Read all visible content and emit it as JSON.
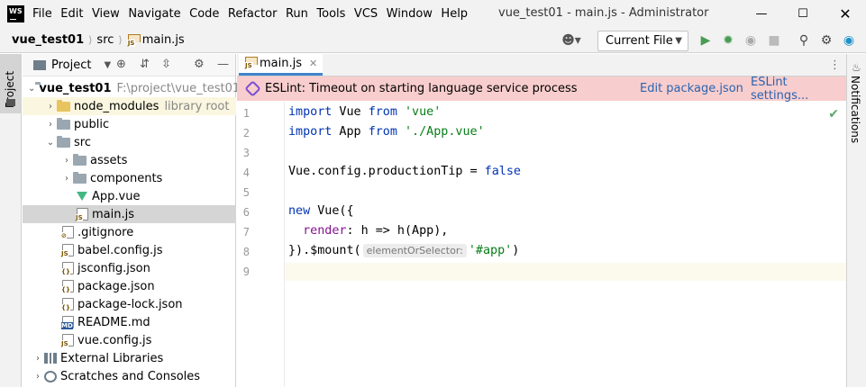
{
  "titlebar": {
    "logo": "WS",
    "menu": [
      "File",
      "Edit",
      "View",
      "Navigate",
      "Code",
      "Refactor",
      "Run",
      "Tools",
      "VCS",
      "Window",
      "Help"
    ],
    "title": "vue_test01 - main.js - Administrator"
  },
  "navbar": {
    "breadcrumbs": [
      "vue_test01",
      "src",
      "main.js"
    ],
    "run_config": "Current File"
  },
  "left_strip": {
    "tab": "Project"
  },
  "right_strip": {
    "tab": "Notifications"
  },
  "project_panel": {
    "title": "Project",
    "tree": [
      {
        "label": "vue_test01",
        "extra": "F:\\project\\vue_test01"
      },
      {
        "label": "node_modules",
        "extra": "library root"
      },
      {
        "label": "public"
      },
      {
        "label": "src"
      },
      {
        "label": "assets"
      },
      {
        "label": "components"
      },
      {
        "label": "App.vue"
      },
      {
        "label": "main.js"
      },
      {
        "label": ".gitignore"
      },
      {
        "label": "babel.config.js"
      },
      {
        "label": "jsconfig.json"
      },
      {
        "label": "package.json"
      },
      {
        "label": "package-lock.json"
      },
      {
        "label": "README.md"
      },
      {
        "label": "vue.config.js"
      },
      {
        "label": "External Libraries"
      },
      {
        "label": "Scratches and Consoles"
      }
    ]
  },
  "editor": {
    "tab": "main.js",
    "banner": {
      "message": "ESLint: Timeout on starting language service process",
      "link1": "Edit package.json",
      "link2": "ESLint settings..."
    },
    "line_numbers": [
      "1",
      "2",
      "3",
      "4",
      "5",
      "6",
      "7",
      "8",
      "9"
    ],
    "code": {
      "l1_kw": "import",
      "l1_id": " Vue ",
      "l1_kw2": "from",
      "l1_str": " 'vue'",
      "l2_kw": "import",
      "l2_id": " App ",
      "l2_kw2": "from",
      "l2_str": " './App.vue'",
      "l4_a": "Vue.config.productionTip = ",
      "l4_kw": "false",
      "l6_kw": "new",
      "l6_rest": " Vue({",
      "l7_prop": "  render",
      "l7_rest": ": h => h(App),",
      "l8_a": "}).$mount(",
      "l8_hint": "elementOrSelector:",
      "l8_str": "'#app'",
      "l8_b": ")"
    }
  },
  "colors": {
    "accent": "#4083c9",
    "banner_bg": "#f8cdcd",
    "keyword": "#0033b3",
    "string": "#067d17",
    "selection": "#d5d5d5"
  }
}
